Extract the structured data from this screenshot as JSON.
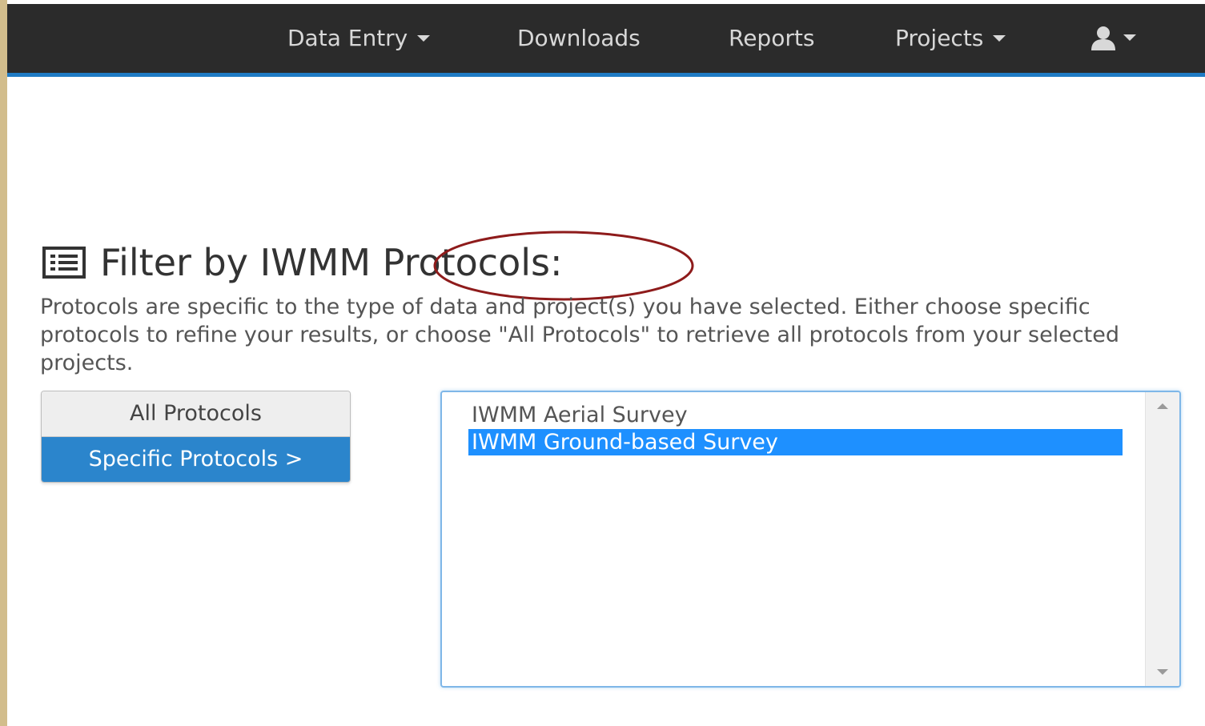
{
  "navbar": {
    "items": [
      {
        "label": "Data Entry",
        "has_caret": true
      },
      {
        "label": "Downloads",
        "has_caret": false
      },
      {
        "label": "Reports",
        "has_caret": false
      },
      {
        "label": "Projects",
        "has_caret": true
      }
    ],
    "user_icon": "user-icon",
    "background_color": "#2b2b2b",
    "accent_color": "#1f7bc4"
  },
  "section": {
    "icon": "list-icon",
    "title": "Filter by IWMM Protocols:",
    "description": "Protocols are specific to the type of data and project(s) you have selected. Either choose specific protocols to refine your results, or choose \"All Protocols\" to retrieve all protocols from your selected projects."
  },
  "toggle": {
    "all_label": "All Protocols",
    "specific_label": "Specific Protocols >",
    "active": "Specific Protocols >",
    "active_color": "#2b85cc"
  },
  "protocol_list": {
    "options": [
      {
        "label": "IWMM Aerial Survey",
        "selected": false
      },
      {
        "label": "IWMM Ground-based Survey",
        "selected": true
      }
    ],
    "selected_color": "#1e90ff"
  },
  "annotation": {
    "shape": "ellipse",
    "color": "#8e1b1b",
    "highlights": "Protocols:"
  }
}
